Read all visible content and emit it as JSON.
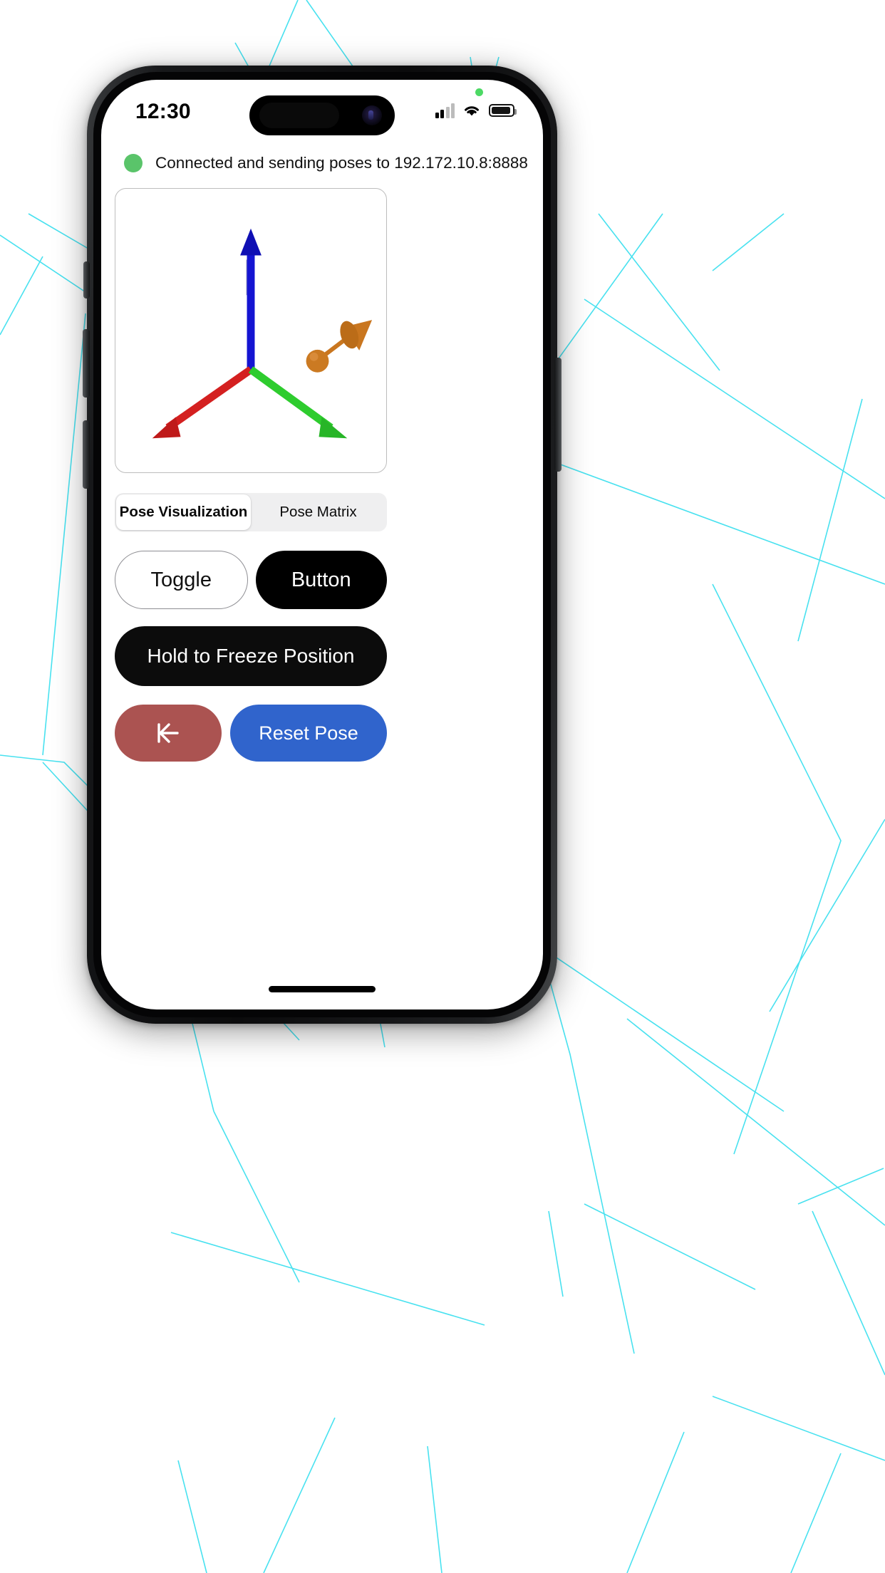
{
  "status_bar": {
    "time": "12:30",
    "icons": [
      "cellular-signal-icon",
      "wifi-icon",
      "battery-icon"
    ],
    "privacy_indicator": "green-privacy-dot",
    "battery_level": "full"
  },
  "connection": {
    "dot_color": "#5ac46a",
    "text": "Connected and sending poses to 192.172.10.8:8888"
  },
  "pose_visualization": {
    "axes": [
      {
        "name": "z-axis",
        "color": "#1414d2",
        "label": "up"
      },
      {
        "name": "x-axis",
        "color": "#d42020",
        "label": "down-left"
      },
      {
        "name": "y-axis",
        "color": "#2ecc2e",
        "label": "down-right"
      }
    ],
    "pose_marker": {
      "name": "pose-arrow",
      "color": "#c9761f",
      "shape": "sphere-with-cone-arrow"
    },
    "background": "#ffffff"
  },
  "segmented_control": {
    "options": [
      {
        "label": "Pose Visualization",
        "selected": true
      },
      {
        "label": "Pose Matrix",
        "selected": false
      }
    ]
  },
  "controls": {
    "toggle_label": "Toggle",
    "button_label": "Button",
    "freeze_label": "Hold to Freeze Position",
    "back_icon": "arrow-left-to-line-icon",
    "reset_label": "Reset Pose"
  },
  "colors": {
    "black_button": "#000000",
    "freeze_button": "#0c0c0c",
    "back_button": "#ab5351",
    "reset_button": "#3064cc",
    "segment_track": "#efeff0",
    "accent_green": "#5ac46a",
    "overlay_lines": "#3fe0ef"
  },
  "home_indicator": "home-indicator-bar"
}
